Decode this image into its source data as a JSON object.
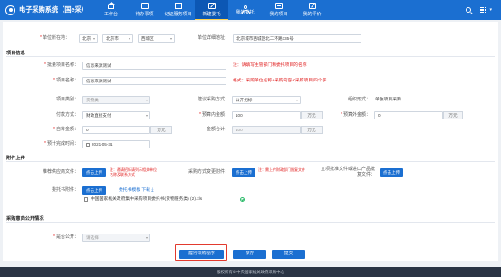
{
  "app": {
    "title": "电子采购系统（国e采）"
  },
  "nav": {
    "items": [
      {
        "label": "工作台",
        "icon": "home-icon"
      },
      {
        "label": "待办事项",
        "icon": "todo-icon"
      },
      {
        "label": "记证服务项目",
        "icon": "service-icon"
      },
      {
        "label": "新建委托",
        "icon": "new-commission-icon"
      },
      {
        "label": "我的委托",
        "icon": "my-commission-icon"
      },
      {
        "label": "我的项目",
        "icon": "my-project-icon"
      },
      {
        "label": "我的评价",
        "icon": "my-review-icon"
      }
    ],
    "user_dropdown": "▾"
  },
  "location": {
    "label": "单位所在地：",
    "province": "北京",
    "city": "北京市",
    "district": "西城区",
    "address_label": "单位详细地址：",
    "address_value": "北京城市西城区北二环路335号"
  },
  "project_info": {
    "section_title": "项目信息",
    "batch_name_label": "批量项目名称：",
    "batch_name_value": "信息来源测试",
    "batch_name_hint": "注：请填写主管部门和委托项目的名称",
    "project_name_label": "项目名称：",
    "project_name_value": "信息来源测试",
    "project_name_hint": "格式：采购单位名称+采购内容+'采购项目'四个字",
    "category_label": "项目类别：",
    "category_value": "货物类",
    "method_label": "建议采购方式：",
    "method_value": "公开招标",
    "org_form_label": "组织形式：",
    "org_form_value": "单独项目采购",
    "payment_label": "付款方式：",
    "payment_value": "财政直接支付",
    "budget_label": "预算内金额：",
    "budget_value": "100",
    "budget_unit": "万元",
    "extra_budget_label": "预算外金额：",
    "extra_budget_value": "0",
    "extra_budget_unit": "万元",
    "self_fund_label": "自筹金额：",
    "self_fund_value": "0",
    "self_fund_unit": "万元",
    "total_label": "金额合计：",
    "total_value": "100",
    "total_unit": "万元",
    "finish_time_label": "预计完成时间：",
    "finish_time_value": "2021-05-31"
  },
  "attachments": {
    "section_title": "附件上传",
    "supplier_list_label": "推荐供应商文件：",
    "upload_label": "点击上传",
    "supplier_hint": "注：邀请招标请列示相关单位名称及联系方式",
    "method_change_label": "采购方式变更附件：",
    "method_change_hint": "注：需上传财政部门批复文件",
    "import_label": "立项批准文件或进口产品批复文件：",
    "entrust_label": "委托书附件：",
    "template_link": "委托书模板 下载",
    "download_icon": "⤓",
    "file_name": "中国国家机关政府集中采购项目委托书(货物服务类) (2).xls"
  },
  "publicity": {
    "section_title": "采购意向公开情况",
    "public_label": "是否公开：",
    "public_placeholder": "请选择"
  },
  "actions": {
    "guide_label": "履行采购程序",
    "save_label": "保存",
    "submit_label": "提交"
  },
  "footer": {
    "text": "版权所有© 中央国家机关政府采购中心"
  },
  "colors": {
    "primary": "#1b6fd1",
    "highlight": "#e23a2e",
    "hint": "#e02020",
    "footer": "#2a3444"
  }
}
